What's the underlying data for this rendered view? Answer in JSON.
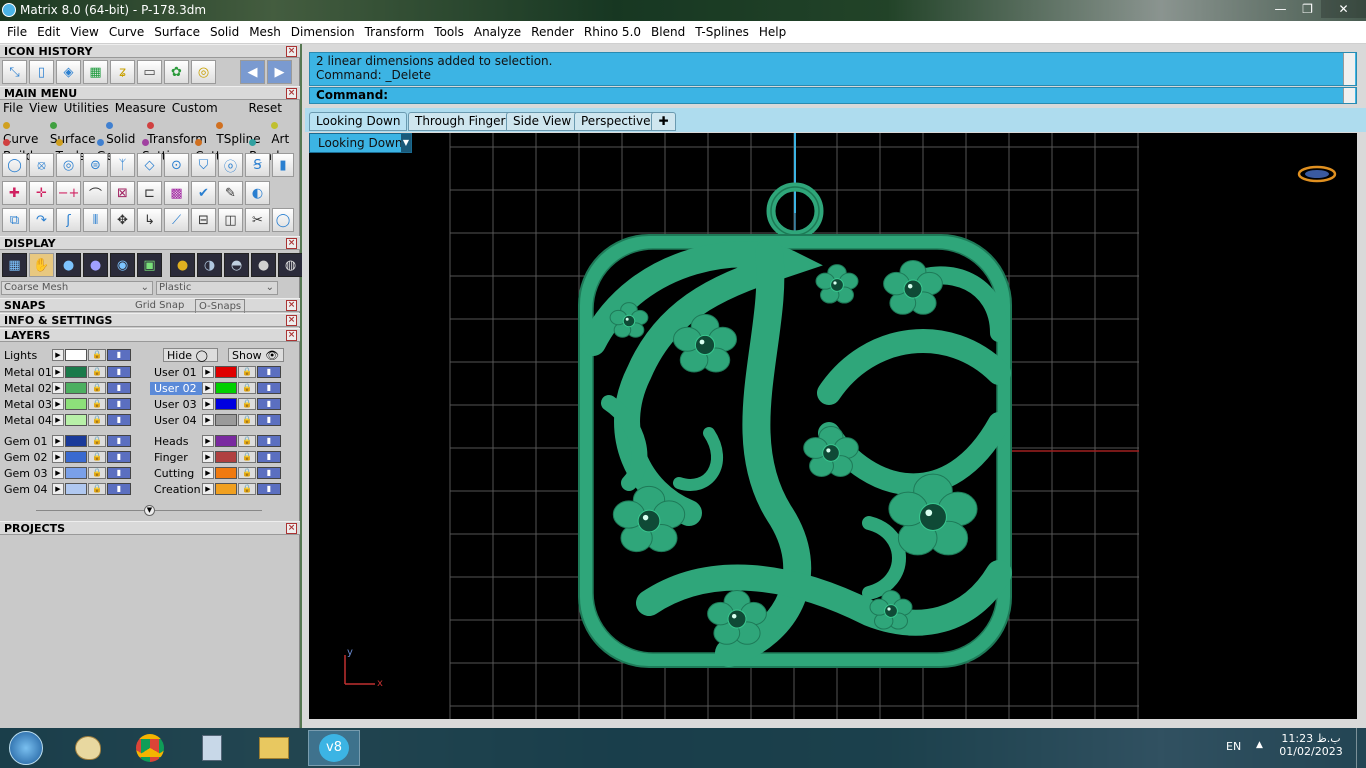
{
  "window": {
    "title": "Matrix 8.0 (64-bit) - P-178.3dm"
  },
  "menu": [
    "File",
    "Edit",
    "View",
    "Curve",
    "Surface",
    "Solid",
    "Mesh",
    "Dimension",
    "Transform",
    "Tools",
    "Analyze",
    "Render",
    "Rhino 5.0",
    "Blend",
    "T-Splines",
    "Help"
  ],
  "panels": {
    "icon_history": "ICON HISTORY",
    "main_menu": "MAIN MENU",
    "display": "DISPLAY",
    "snaps": "SNAPS",
    "info": "INFO & SETTINGS",
    "layers": "LAYERS",
    "projects": "PROJECTS"
  },
  "main_menu": {
    "items": [
      "File",
      "View",
      "Utilities",
      "Measure",
      "Custom"
    ],
    "reset": "Reset",
    "cats1": [
      "Curve",
      "Surface",
      "Solid",
      "Transform",
      "TSpline",
      "Art"
    ],
    "cats2": [
      "Builder",
      "Tools",
      "Gems",
      "Setting",
      "Cutters",
      "Render"
    ]
  },
  "display": {
    "mesh": "Coarse Mesh",
    "material": "Plastic"
  },
  "snaps": {
    "grid": "Grid Snap",
    "osnaps": "O-Snaps"
  },
  "layers": {
    "lights": "Lights",
    "hide": "Hide",
    "show": "Show",
    "left": [
      {
        "name": "Metal 01",
        "color": "#1a7a4a"
      },
      {
        "name": "Metal 02",
        "color": "#4caf60"
      },
      {
        "name": "Metal 03",
        "color": "#8de07a"
      },
      {
        "name": "Metal 04",
        "color": "#b8f0a8"
      },
      {
        "name": "Gem 01",
        "color": "#1a3a9a"
      },
      {
        "name": "Gem 02",
        "color": "#3a6ad0"
      },
      {
        "name": "Gem 03",
        "color": "#7aa0e8"
      },
      {
        "name": "Gem 04",
        "color": "#b0c8f0"
      }
    ],
    "right": [
      {
        "name": "User 01",
        "color": "#e00000"
      },
      {
        "name": "User 02",
        "color": "#00d000"
      },
      {
        "name": "User 03",
        "color": "#0000e0"
      },
      {
        "name": "User 04",
        "color": "#9a9a9a"
      },
      {
        "name": "Heads",
        "color": "#7a2aa0"
      },
      {
        "name": "Finger",
        "color": "#b04040"
      },
      {
        "name": "Cutting",
        "color": "#f07a10"
      },
      {
        "name": "Creation",
        "color": "#f0a020"
      }
    ],
    "selected_right": "User 02"
  },
  "command": {
    "line1": "2 linear dimensions added to selection.",
    "line2": "Command: _Delete",
    "prompt": "Command:"
  },
  "viewport_tabs": [
    "Looking Down",
    "Through Finger",
    "Side View",
    "Perspective"
  ],
  "viewport": {
    "name": "Looking Down",
    "axis_x": "x",
    "axis_y": "y"
  },
  "tray": {
    "lang": "EN",
    "time": "11:23 ب.ظ",
    "date": "01/02/2023"
  },
  "colors": {
    "model": "#2fa67a",
    "cmd_bg": "#3cb4e4",
    "grid": "#5a5a5a"
  }
}
